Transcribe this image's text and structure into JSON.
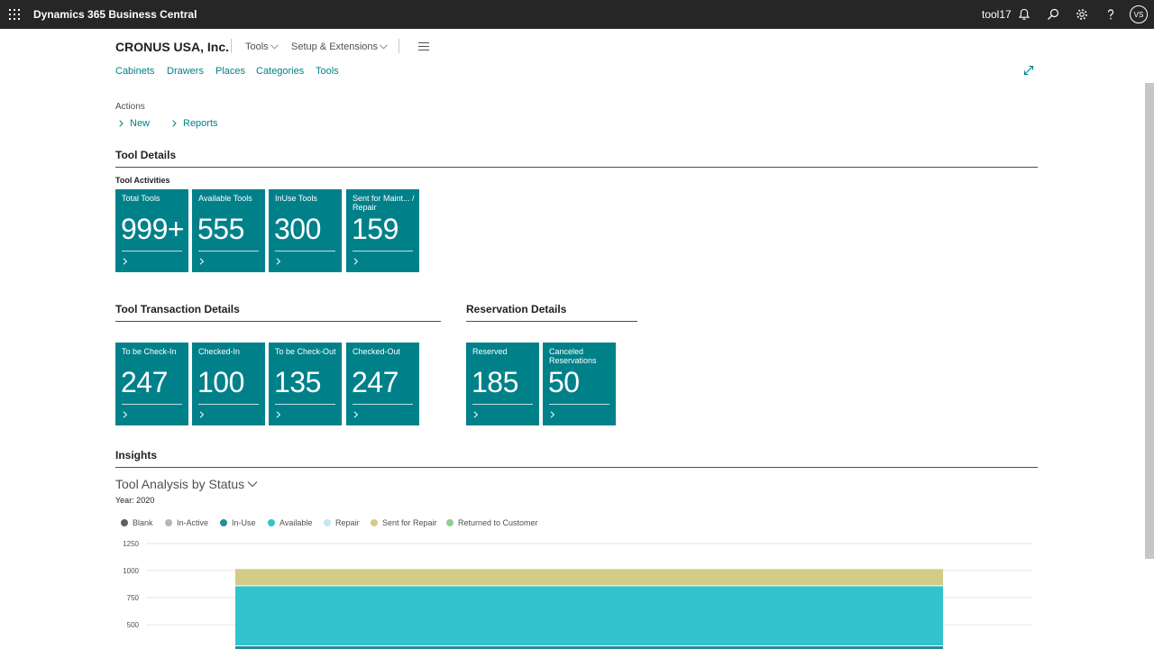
{
  "topbar": {
    "app_title": "Dynamics 365 Business Central",
    "company_code": "tool17",
    "avatar_initials": "VS",
    "icons": [
      "waffle-icon",
      "bell-icon",
      "search-icon",
      "gear-icon",
      "help-icon"
    ]
  },
  "header": {
    "company": "CRONUS USA, Inc.",
    "menus": [
      "Tools",
      "Setup & Extensions"
    ]
  },
  "nav": {
    "links": [
      "Cabinets",
      "Drawers",
      "Places",
      "Categories",
      "Tools"
    ]
  },
  "actions": {
    "label": "Actions",
    "items": [
      "New",
      "Reports"
    ]
  },
  "tool_details": {
    "title": "Tool Details",
    "group": "Tool Activities",
    "tiles": [
      {
        "label": "Total Tools",
        "value": "999+"
      },
      {
        "label": "Available Tools",
        "value": "555"
      },
      {
        "label": "InUse Tools",
        "value": "300"
      },
      {
        "label": "Sent for Maint... / Repair",
        "value": "159"
      }
    ]
  },
  "transaction_details": {
    "title": "Tool Transaction Details",
    "tiles": [
      {
        "label": "To be Check-In",
        "value": "247"
      },
      {
        "label": "Checked-In",
        "value": "100"
      },
      {
        "label": "To be Check-Out",
        "value": "135"
      },
      {
        "label": "Checked-Out",
        "value": "247"
      }
    ]
  },
  "reservation_details": {
    "title": "Reservation Details",
    "tiles": [
      {
        "label": "Reserved",
        "value": "185"
      },
      {
        "label": "Canceled Reservations",
        "value": "50"
      }
    ]
  },
  "insights": {
    "title": "Insights",
    "chart_title": "Tool Analysis by Status",
    "chart_subtitle": "Year: 2020"
  },
  "colors": {
    "accent": "#00818a",
    "topbar": "#262626",
    "Blank": "#5a6066",
    "In-Active": "#b3b7bd",
    "In-Use": "#268c96",
    "Available": "#33c3cf",
    "Repair": "#bfe9ec",
    "Sent for Repair": "#d3cc88",
    "Returned to Customer": "#8fd08f"
  },
  "chart_data": {
    "type": "bar",
    "stacked": true,
    "title": "Tool Analysis by Status",
    "subtitle": "Year: 2020",
    "categories": [
      "2020"
    ],
    "y_ticks": [
      1250,
      1000,
      750,
      500
    ],
    "ylim": [
      0,
      1250
    ],
    "grid": true,
    "legend_position": "top-left",
    "series": [
      {
        "name": "Blank",
        "values": [
          0
        ]
      },
      {
        "name": "In-Active",
        "values": [
          0
        ]
      },
      {
        "name": "In-Use",
        "values": [
          300
        ]
      },
      {
        "name": "Available",
        "values": [
          555
        ]
      },
      {
        "name": "Repair",
        "values": [
          0
        ]
      },
      {
        "name": "Sent for Repair",
        "values": [
          159
        ]
      },
      {
        "name": "Returned to Customer",
        "values": [
          0
        ]
      }
    ]
  }
}
